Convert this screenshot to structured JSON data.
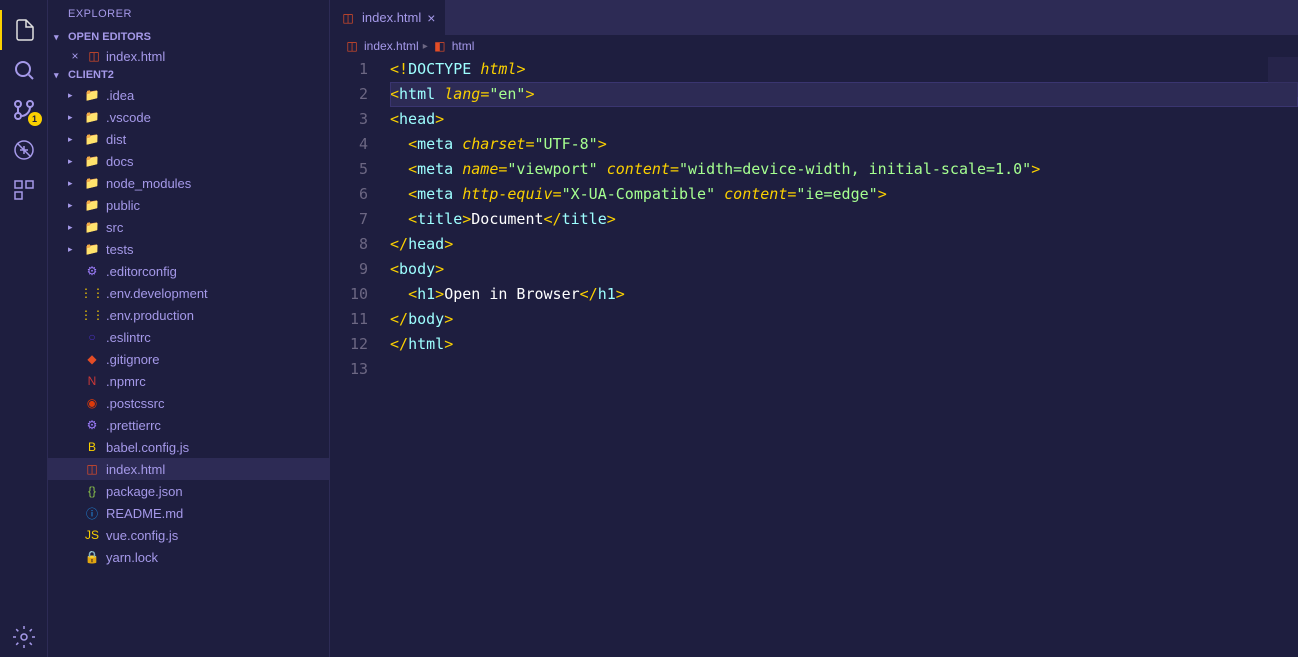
{
  "sidebar": {
    "title": "EXPLORER",
    "openEditorsHeader": "OPEN EDITORS",
    "openEditors": [
      {
        "name": "index.html",
        "icon": "html"
      }
    ],
    "projectHeader": "CLIENT2",
    "tree": [
      {
        "type": "folder",
        "name": ".idea",
        "icon": "folder"
      },
      {
        "type": "folder",
        "name": ".vscode",
        "icon": "vscode"
      },
      {
        "type": "folder",
        "name": "dist",
        "icon": "folder"
      },
      {
        "type": "folder",
        "name": "docs",
        "icon": "folder"
      },
      {
        "type": "folder",
        "name": "node_modules",
        "icon": "folder-src"
      },
      {
        "type": "folder",
        "name": "public",
        "icon": "folder-src"
      },
      {
        "type": "folder",
        "name": "src",
        "icon": "folder-src"
      },
      {
        "type": "folder",
        "name": "tests",
        "icon": "folder-src"
      },
      {
        "type": "file",
        "name": ".editorconfig",
        "icon": "config"
      },
      {
        "type": "file",
        "name": ".env.development",
        "icon": "env"
      },
      {
        "type": "file",
        "name": ".env.production",
        "icon": "env"
      },
      {
        "type": "file",
        "name": ".eslintrc",
        "icon": "eslint"
      },
      {
        "type": "file",
        "name": ".gitignore",
        "icon": "git"
      },
      {
        "type": "file",
        "name": ".npmrc",
        "icon": "npm"
      },
      {
        "type": "file",
        "name": ".postcssrc",
        "icon": "post"
      },
      {
        "type": "file",
        "name": ".prettierrc",
        "icon": "config"
      },
      {
        "type": "file",
        "name": "babel.config.js",
        "icon": "babel"
      },
      {
        "type": "file",
        "name": "index.html",
        "icon": "html",
        "selected": true
      },
      {
        "type": "file",
        "name": "package.json",
        "icon": "json"
      },
      {
        "type": "file",
        "name": "README.md",
        "icon": "md"
      },
      {
        "type": "file",
        "name": "vue.config.js",
        "icon": "js"
      },
      {
        "type": "file",
        "name": "yarn.lock",
        "icon": "yarn"
      }
    ]
  },
  "activityBar": {
    "scmBadge": "1"
  },
  "tabs": [
    {
      "name": "index.html",
      "icon": "html"
    }
  ],
  "breadcrumb": [
    {
      "name": "index.html",
      "icon": "html"
    },
    {
      "name": "html",
      "icon": "tag"
    }
  ],
  "code": {
    "highlightLine": 2,
    "lines": [
      [
        {
          "t": "bracket",
          "v": "<!"
        },
        {
          "t": "doctype",
          "v": "DOCTYPE "
        },
        {
          "t": "doctype-kw",
          "v": "html"
        },
        {
          "t": "bracket",
          "v": ">"
        }
      ],
      [
        {
          "t": "bracket",
          "v": "<"
        },
        {
          "t": "tag",
          "v": "html "
        },
        {
          "t": "attr",
          "v": "lang"
        },
        {
          "t": "bracket",
          "v": "="
        },
        {
          "t": "string",
          "v": "\"en\""
        },
        {
          "t": "bracket",
          "v": ">"
        }
      ],
      [
        {
          "t": "bracket",
          "v": "<"
        },
        {
          "t": "tag",
          "v": "head"
        },
        {
          "t": "bracket",
          "v": ">"
        }
      ],
      [
        {
          "t": "text",
          "v": "  "
        },
        {
          "t": "bracket",
          "v": "<"
        },
        {
          "t": "tag",
          "v": "meta "
        },
        {
          "t": "attr",
          "v": "charset"
        },
        {
          "t": "bracket",
          "v": "="
        },
        {
          "t": "string",
          "v": "\"UTF-8\""
        },
        {
          "t": "bracket",
          "v": ">"
        }
      ],
      [
        {
          "t": "text",
          "v": "  "
        },
        {
          "t": "bracket",
          "v": "<"
        },
        {
          "t": "tag",
          "v": "meta "
        },
        {
          "t": "attr",
          "v": "name"
        },
        {
          "t": "bracket",
          "v": "="
        },
        {
          "t": "string",
          "v": "\"viewport\" "
        },
        {
          "t": "attr",
          "v": "content"
        },
        {
          "t": "bracket",
          "v": "="
        },
        {
          "t": "string",
          "v": "\"width=device-width, initial-scale=1.0\""
        },
        {
          "t": "bracket",
          "v": ">"
        }
      ],
      [
        {
          "t": "text",
          "v": "  "
        },
        {
          "t": "bracket",
          "v": "<"
        },
        {
          "t": "tag",
          "v": "meta "
        },
        {
          "t": "attr",
          "v": "http-equiv"
        },
        {
          "t": "bracket",
          "v": "="
        },
        {
          "t": "string",
          "v": "\"X-UA-Compatible\" "
        },
        {
          "t": "attr",
          "v": "content"
        },
        {
          "t": "bracket",
          "v": "="
        },
        {
          "t": "string",
          "v": "\"ie=edge\""
        },
        {
          "t": "bracket",
          "v": ">"
        }
      ],
      [
        {
          "t": "text",
          "v": "  "
        },
        {
          "t": "bracket",
          "v": "<"
        },
        {
          "t": "tag",
          "v": "title"
        },
        {
          "t": "bracket",
          "v": ">"
        },
        {
          "t": "text",
          "v": "Document"
        },
        {
          "t": "bracket",
          "v": "</"
        },
        {
          "t": "tag",
          "v": "title"
        },
        {
          "t": "bracket",
          "v": ">"
        }
      ],
      [
        {
          "t": "bracket",
          "v": "</"
        },
        {
          "t": "tag",
          "v": "head"
        },
        {
          "t": "bracket",
          "v": ">"
        }
      ],
      [
        {
          "t": "bracket",
          "v": "<"
        },
        {
          "t": "tag",
          "v": "body"
        },
        {
          "t": "bracket",
          "v": ">"
        }
      ],
      [
        {
          "t": "text",
          "v": "  "
        },
        {
          "t": "bracket",
          "v": "<"
        },
        {
          "t": "tag",
          "v": "h1"
        },
        {
          "t": "bracket",
          "v": ">"
        },
        {
          "t": "text",
          "v": "Open in Browser"
        },
        {
          "t": "bracket",
          "v": "</"
        },
        {
          "t": "tag",
          "v": "h1"
        },
        {
          "t": "bracket",
          "v": ">"
        }
      ],
      [
        {
          "t": "bracket",
          "v": "</"
        },
        {
          "t": "tag",
          "v": "body"
        },
        {
          "t": "bracket",
          "v": ">"
        }
      ],
      [
        {
          "t": "bracket",
          "v": "</"
        },
        {
          "t": "tag",
          "v": "html"
        },
        {
          "t": "bracket",
          "v": ">"
        }
      ],
      []
    ]
  }
}
